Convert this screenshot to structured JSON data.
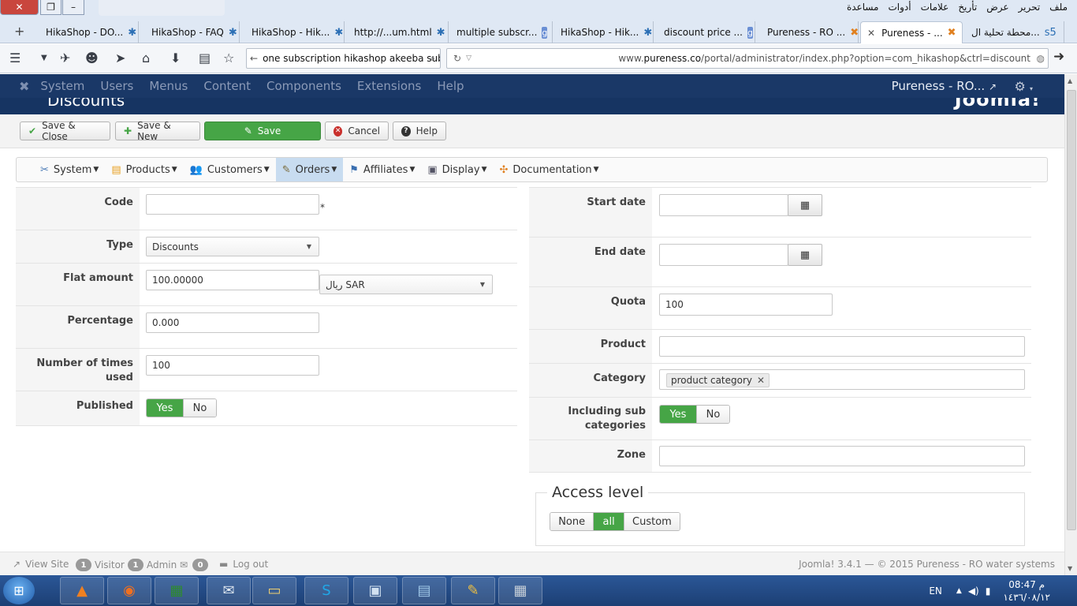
{
  "browser": {
    "window_controls": {
      "close": "✕",
      "maximize": "❐",
      "minimize": "–"
    },
    "menu": [
      "ملف",
      "تحرير",
      "عرض",
      "تأريخ",
      "علامات",
      "أدوات",
      "مساعدة"
    ],
    "new_tab": "+",
    "tabs": [
      {
        "label": "HikaShop - DO...",
        "icon": "✱",
        "icon_name": "hikashop-icon"
      },
      {
        "label": "HikaShop - FAQ",
        "icon": "✱",
        "icon_name": "hikashop-icon"
      },
      {
        "label": "HikaShop - Hik...",
        "icon": "✱",
        "icon_name": "hikashop-icon"
      },
      {
        "label": "http://...um.html",
        "icon": "✱",
        "icon_name": "hikashop-icon"
      },
      {
        "label": "multiple subscr...",
        "icon": "g",
        "icon_name": "google-icon"
      },
      {
        "label": "HikaShop - Hik...",
        "icon": "✱",
        "icon_name": "hikashop-icon"
      },
      {
        "label": "discount price ...",
        "icon": "g",
        "icon_name": "google-icon"
      },
      {
        "label": "Pureness - RO ...",
        "icon": "✖",
        "icon_name": "joomla-icon"
      },
      {
        "label": "Pureness - ...",
        "icon": "✖",
        "icon_name": "joomla-icon",
        "active": true
      },
      {
        "label": "محطة تحلية ال...",
        "icon": "s5",
        "icon_name": "site-icon"
      }
    ],
    "search_text": "one subscription hikashop akeeba subs",
    "url_prefix": "www.",
    "url_domain": "pureness.co",
    "url_rest": "/portal/administrator/index.php?option=com_hikashop&ctrl=discount"
  },
  "joomla": {
    "nav": [
      "System",
      "Users",
      "Menus",
      "Content",
      "Components",
      "Extensions",
      "Help"
    ],
    "site_name": "Pureness - RO...",
    "page_title": "Discounts",
    "brand": "Joomla!"
  },
  "toolbar": {
    "save_close": "Save & Close",
    "save_new": "Save & New",
    "save": "Save",
    "cancel": "Cancel",
    "help": "Help"
  },
  "hika_menu": [
    {
      "label": "System",
      "icon_name": "tools-icon",
      "icon": "✂"
    },
    {
      "label": "Products",
      "icon_name": "products-icon",
      "icon": "▤"
    },
    {
      "label": "Customers",
      "icon_name": "customers-icon",
      "icon": "👥"
    },
    {
      "label": "Orders",
      "icon_name": "orders-icon",
      "icon": "✎",
      "active": true
    },
    {
      "label": "Affiliates",
      "icon_name": "affiliates-icon",
      "icon": "⚑"
    },
    {
      "label": "Display",
      "icon_name": "display-icon",
      "icon": "▣"
    },
    {
      "label": "Documentation",
      "icon_name": "documentation-icon",
      "icon": "✣"
    }
  ],
  "form_left": {
    "code": {
      "label": "Code",
      "value": "",
      "required_mark": "*"
    },
    "type": {
      "label": "Type",
      "value": "Discounts"
    },
    "flat_amount": {
      "label": "Flat amount",
      "value": "100.00000",
      "currency": "ريال SAR"
    },
    "percentage": {
      "label": "Percentage",
      "value": "0.000"
    },
    "times_used": {
      "label": "Number of times used",
      "value": "100"
    },
    "published": {
      "label": "Published",
      "yes": "Yes",
      "no": "No",
      "selected": "Yes"
    }
  },
  "form_right": {
    "start_date": {
      "label": "Start date",
      "value": ""
    },
    "end_date": {
      "label": "End date",
      "value": ""
    },
    "quota": {
      "label": "Quota",
      "value": "100"
    },
    "product": {
      "label": "Product",
      "value": ""
    },
    "category": {
      "label": "Category",
      "chip": "product category"
    },
    "sub_categories": {
      "label": "Including sub categories",
      "yes": "Yes",
      "no": "No",
      "selected": "Yes"
    },
    "zone": {
      "label": "Zone",
      "value": ""
    }
  },
  "access_level": {
    "title": "Access level",
    "options": [
      "None",
      "all",
      "Custom"
    ],
    "selected": "all"
  },
  "status": {
    "view_site": "View Site",
    "visitors_count": "1",
    "visitors_label": "Visitor",
    "admins_count": "1",
    "admins_label": "Admin",
    "messages_count": "0",
    "logout": "Log out",
    "footer": "Joomla! 3.4.1 — © 2015 Pureness - RO water systems"
  },
  "taskbar": {
    "lang": "EN",
    "time": "08:47 م",
    "date": "١٤٣٦/٠٨/١٢"
  }
}
